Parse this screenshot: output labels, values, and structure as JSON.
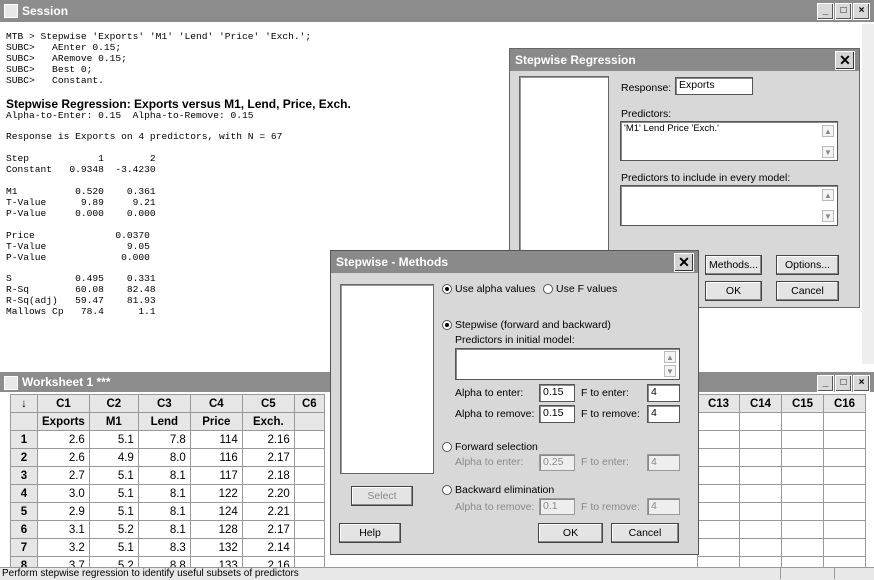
{
  "session": {
    "title": "Session",
    "command_lines": [
      "MTB > Stepwise 'Exports' 'M1' 'Lend' 'Price' 'Exch.';",
      "SUBC>   AEnter 0.15;",
      "SUBC>   ARemove 0.15;",
      "SUBC>   Best 0;",
      "SUBC>   Constant."
    ],
    "heading": "Stepwise Regression: Exports versus M1, Lend, Price, Exch.",
    "alpha_line": "Alpha-to-Enter: 0.15  Alpha-to-Remove: 0.15",
    "response_line": "Response is Exports on 4 predictors, with N = 67",
    "output_lines": [
      "Step            1        2",
      "Constant   0.9348  -3.4230",
      "",
      "M1          0.520    0.361",
      "T-Value      9.89     9.21",
      "P-Value     0.000    0.000",
      "",
      "Price              0.0370",
      "T-Value              9.05",
      "P-Value             0.000",
      "",
      "S           0.495    0.331",
      "R-Sq        60.08    82.48",
      "R-Sq(adj)   59.47    81.93",
      "Mallows Cp   78.4      1.1"
    ]
  },
  "regression_dialog": {
    "title": "Stepwise Regression",
    "response_label": "Response:",
    "response_value": "Exports",
    "predictors_label": "Predictors:",
    "predictors_value": "'M1' Lend Price 'Exch.'",
    "include_label": "Predictors to include in every model:",
    "methods_button": "Methods...",
    "options_button": "Options...",
    "ok_button": "OK",
    "cancel_button": "Cancel"
  },
  "methods_dialog": {
    "title": "Stepwise - Methods",
    "use_alpha": "Use alpha values",
    "use_f": "Use F values",
    "stepwise_option": "Stepwise (forward and backward)",
    "initial_model_label": "Predictors in initial model:",
    "alpha_enter_label": "Alpha to enter:",
    "alpha_enter_value": "0.15",
    "f_enter_label": "F to enter:",
    "f_enter_value": "4",
    "alpha_remove_label": "Alpha to remove:",
    "alpha_remove_value": "0.15",
    "f_remove_label": "F to remove:",
    "f_remove_value": "4",
    "forward_option": "Forward selection",
    "fwd_alpha_label": "Alpha to enter:",
    "fwd_alpha_value": "0.25",
    "fwd_f_label": "F to enter:",
    "fwd_f_value": "4",
    "backward_option": "Backward elimination",
    "bwd_alpha_label": "Alpha to remove:",
    "bwd_alpha_value": "0.1",
    "bwd_f_label": "F to remove:",
    "bwd_f_value": "4",
    "select_button": "Select",
    "help_button": "Help",
    "ok_button": "OK",
    "cancel_button": "Cancel"
  },
  "worksheet": {
    "title": "Worksheet 1 ***",
    "arrow": "↓",
    "columns": [
      "C1",
      "C2",
      "C3",
      "C4",
      "C5",
      "C6"
    ],
    "names": [
      "Exports",
      "M1",
      "Lend",
      "Price",
      "Exch.",
      ""
    ],
    "right_columns": [
      "C13",
      "C14",
      "C15",
      "C16"
    ],
    "rows": [
      [
        "1",
        "2.6",
        "5.1",
        "7.8",
        "114",
        "2.16"
      ],
      [
        "2",
        "2.6",
        "4.9",
        "8.0",
        "116",
        "2.17"
      ],
      [
        "3",
        "2.7",
        "5.1",
        "8.1",
        "117",
        "2.18"
      ],
      [
        "4",
        "3.0",
        "5.1",
        "8.1",
        "122",
        "2.20"
      ],
      [
        "5",
        "2.9",
        "5.1",
        "8.1",
        "124",
        "2.21"
      ],
      [
        "6",
        "3.1",
        "5.2",
        "8.1",
        "128",
        "2.17"
      ],
      [
        "7",
        "3.2",
        "5.1",
        "8.3",
        "132",
        "2.14"
      ],
      [
        "8",
        "3.7",
        "5.2",
        "8.8",
        "133",
        "2.16"
      ]
    ]
  },
  "status_bar": "Perform stepwise regression to identify useful subsets of predictors"
}
